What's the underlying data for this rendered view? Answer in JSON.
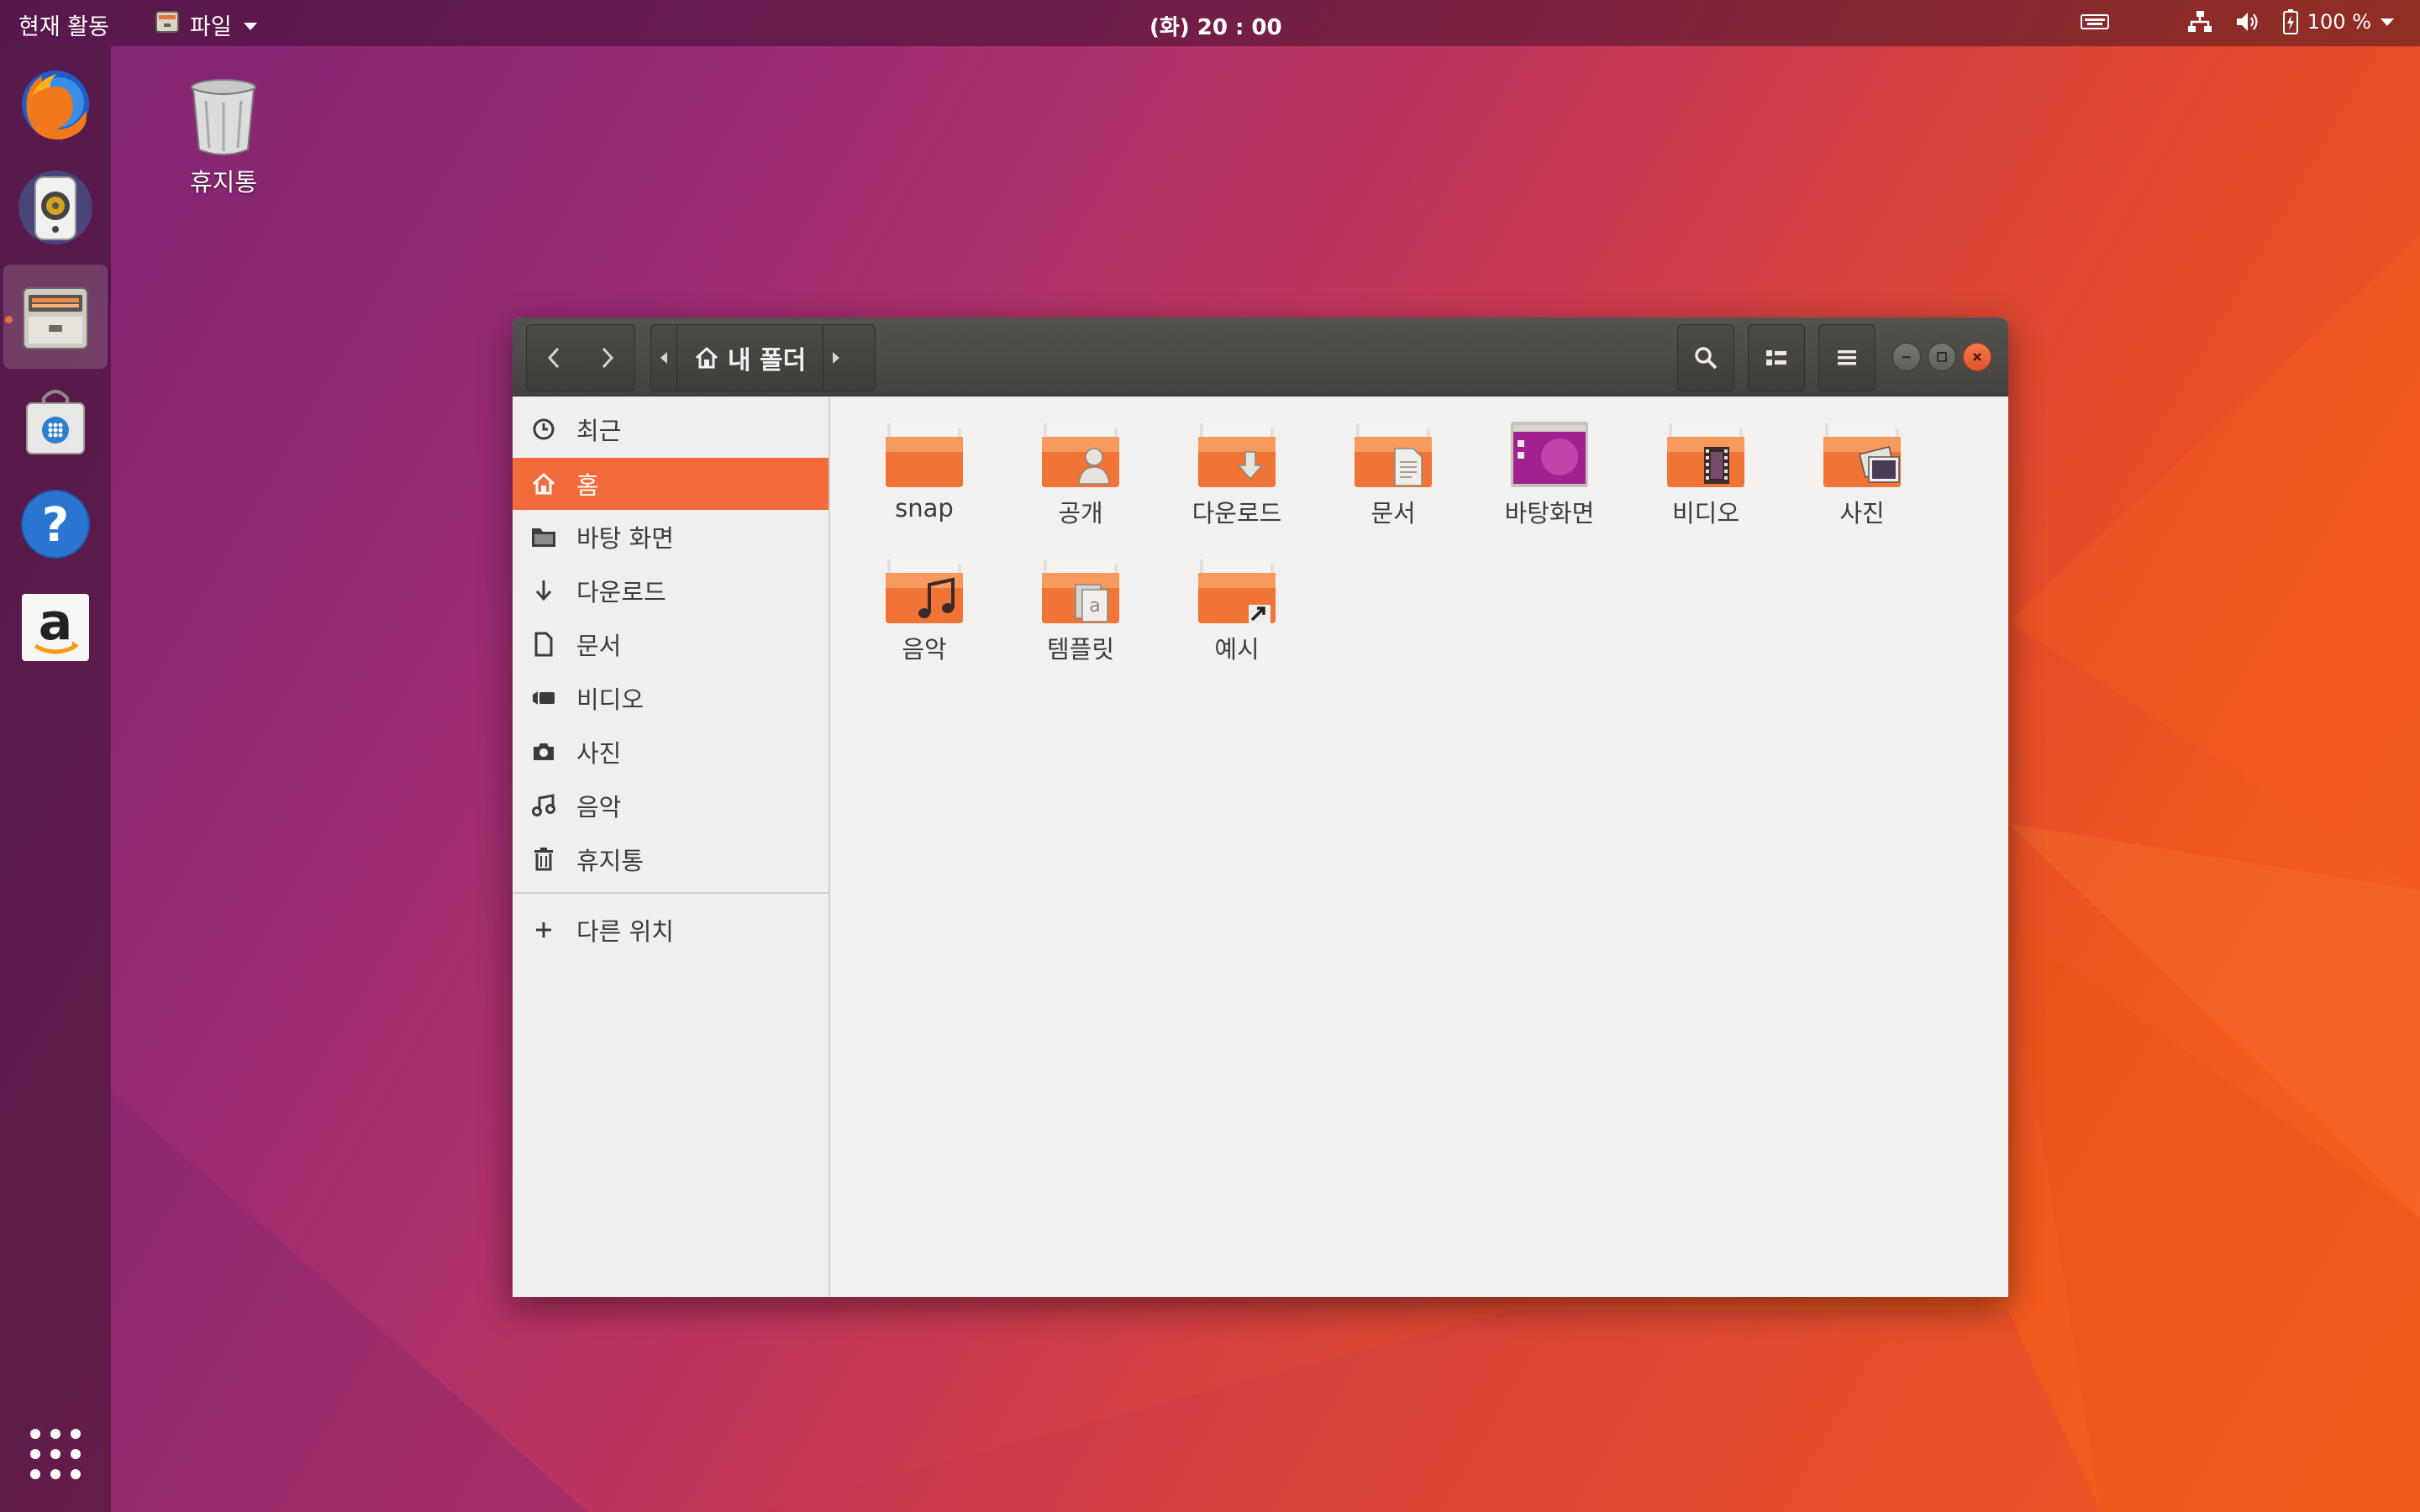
{
  "topbar": {
    "activities": "현재 활동",
    "app_menu": "파일",
    "clock": "(화) 20 : 00",
    "battery": "100 %"
  },
  "dock": {
    "items": [
      {
        "name": "firefox",
        "icon": "firefox-icon"
      },
      {
        "name": "rhythmbox",
        "icon": "speaker-icon"
      },
      {
        "name": "files",
        "icon": "file-cabinet-icon",
        "active": true
      },
      {
        "name": "software",
        "icon": "shopping-bag-icon"
      },
      {
        "name": "help",
        "icon": "help-icon"
      },
      {
        "name": "amazon",
        "icon": "amazon-icon"
      }
    ],
    "show_apps_icon": "grid-icon"
  },
  "desktop": {
    "trash_label": "휴지통"
  },
  "window": {
    "path_label": "내 폴더",
    "sidebar": {
      "items": [
        {
          "label": "최근",
          "icon": "clock-icon"
        },
        {
          "label": "홈",
          "icon": "home-icon",
          "selected": true
        },
        {
          "label": "바탕 화면",
          "icon": "folder-icon"
        },
        {
          "label": "다운로드",
          "icon": "download-icon"
        },
        {
          "label": "문서",
          "icon": "document-icon"
        },
        {
          "label": "비디오",
          "icon": "video-icon"
        },
        {
          "label": "사진",
          "icon": "camera-icon"
        },
        {
          "label": "음악",
          "icon": "music-icon"
        },
        {
          "label": "휴지통",
          "icon": "trash-icon"
        }
      ],
      "other_locations": "다른 위치"
    },
    "folders": [
      {
        "label": "snap",
        "icon": "folder-icon"
      },
      {
        "label": "공개",
        "icon": "folder-public-icon"
      },
      {
        "label": "다운로드",
        "icon": "folder-download-icon"
      },
      {
        "label": "문서",
        "icon": "folder-documents-icon"
      },
      {
        "label": "바탕화면",
        "icon": "folder-desktop-icon"
      },
      {
        "label": "비디오",
        "icon": "folder-videos-icon"
      },
      {
        "label": "사진",
        "icon": "folder-pictures-icon"
      },
      {
        "label": "음악",
        "icon": "folder-music-icon"
      },
      {
        "label": "템플릿",
        "icon": "folder-templates-icon"
      },
      {
        "label": "예시",
        "icon": "folder-link-icon"
      }
    ]
  },
  "colors": {
    "accent": "#f26b3a",
    "folder": "#f08040",
    "headerbar": "#4a4844"
  }
}
